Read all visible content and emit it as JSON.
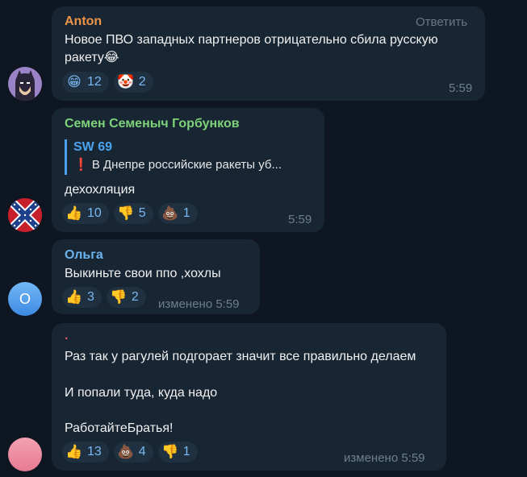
{
  "messages": [
    {
      "author": "Anton",
      "author_color": "#ee9446",
      "reply_label": "Ответить",
      "lines": [
        "Новое ПВО западных партнеров отрицательно сбила русскую",
        "ракету😂"
      ],
      "reactions": [
        {
          "emoji": "😁",
          "count": "12"
        },
        {
          "emoji": "🤡",
          "count": "2"
        }
      ],
      "time": "5:59"
    },
    {
      "author": "Семен Семеныч Горбунков",
      "author_color": "#7ed27a",
      "quote": {
        "author": "SW 69",
        "text": "❗ В Днепре российские ракеты уб..."
      },
      "lines": [
        "дехохляция"
      ],
      "reactions": [
        {
          "emoji": "👍",
          "count": "10"
        },
        {
          "emoji": "👎",
          "count": "5"
        },
        {
          "emoji": "💩",
          "count": "1"
        }
      ],
      "time": "5:59"
    },
    {
      "author": "Ольга",
      "author_color": "#6cb4f0",
      "avatar_letter": "О",
      "lines": [
        "Выкиньте свои ппо ,хохлы"
      ],
      "reactions": [
        {
          "emoji": "👍",
          "count": "3"
        },
        {
          "emoji": "👎",
          "count": "2"
        }
      ],
      "time": "изменено 5:59"
    },
    {
      "author": ".",
      "author_color": "#e4556c",
      "lines": [
        "Раз так у рагулей подгорает значит все правильно делаем",
        "",
        "И попали туда, куда надо",
        "",
        "РаботайтеБратья!"
      ],
      "reactions": [
        {
          "emoji": "👍",
          "count": "13"
        },
        {
          "emoji": "💩",
          "count": "4"
        },
        {
          "emoji": "👎",
          "count": "1"
        }
      ],
      "time": "изменено 5:59"
    }
  ]
}
